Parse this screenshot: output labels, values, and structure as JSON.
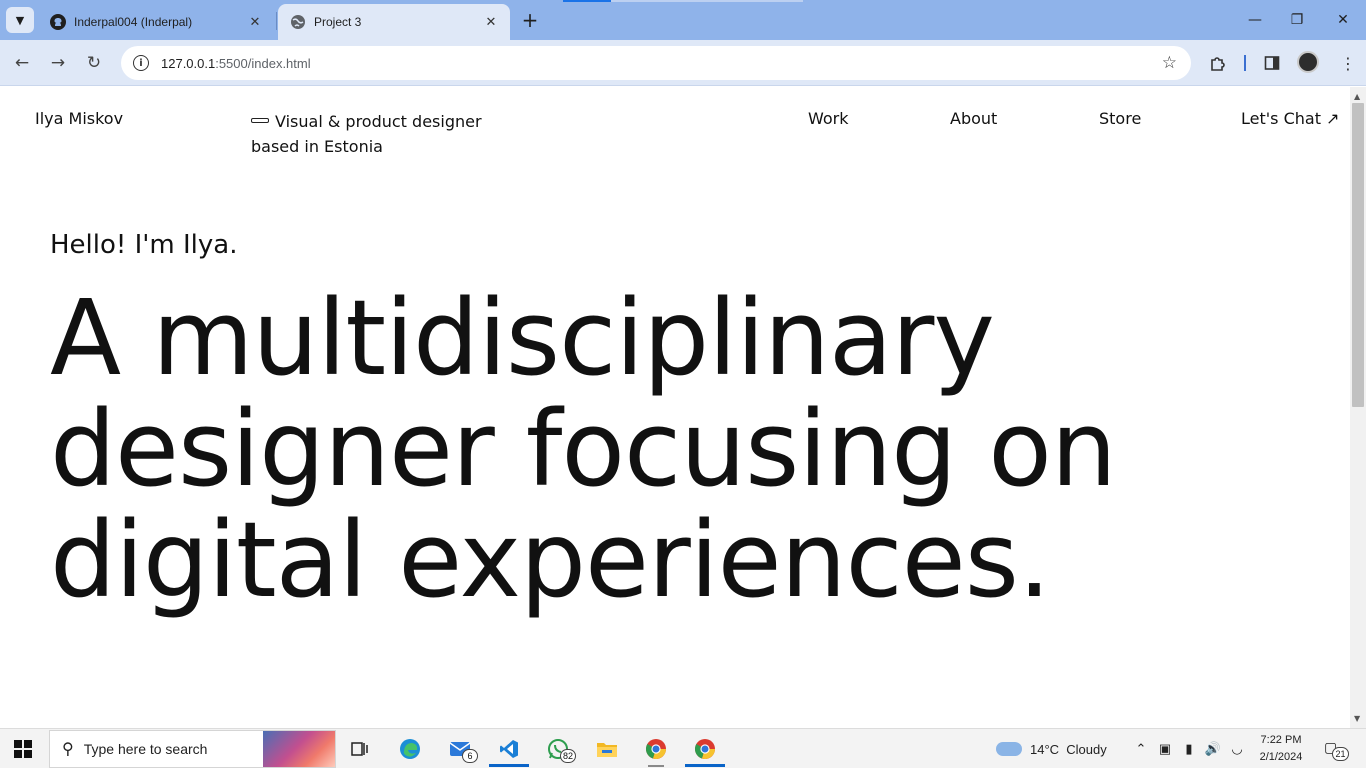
{
  "browser": {
    "tabs": [
      {
        "title": "Inderpal004 (Inderpal)",
        "icon": "github-icon"
      },
      {
        "title": "Project 3",
        "icon": "globe-icon"
      }
    ],
    "url_host": "127.0.0.1",
    "url_rest": ":5500/index.html"
  },
  "site": {
    "name": "Ilya Miskov",
    "tagline": "Visual & product designer based in Estonia",
    "nav": [
      "Work",
      "About",
      "Store",
      "Let's Chat ↗"
    ],
    "hello": "Hello! I'm Ilya.",
    "headline": "A multidisciplinary designer focusing on digital experiences."
  },
  "taskbar": {
    "search_placeholder": "Type here to search",
    "mail_badge": "6",
    "whatsapp_badge": "82",
    "weather": "14°C  Cloudy",
    "time": "7:22 PM",
    "date": "2/1/2024",
    "notifications": "21"
  }
}
